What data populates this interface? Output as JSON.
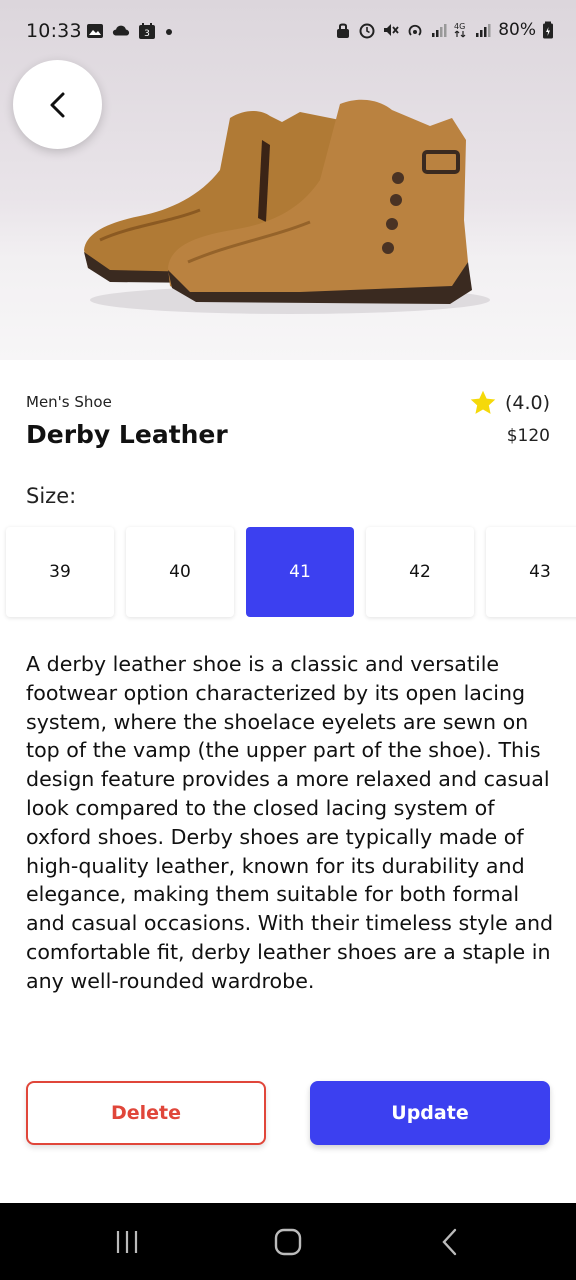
{
  "status_bar": {
    "time": "10:33",
    "battery": "80%",
    "network": "4G"
  },
  "product": {
    "category": "Men's Shoe",
    "name": "Derby Leather",
    "rating": "(4.0)",
    "price": "$120",
    "size_label": "Size:",
    "sizes": [
      {
        "label": "39",
        "selected": false
      },
      {
        "label": "40",
        "selected": false
      },
      {
        "label": "41",
        "selected": true
      },
      {
        "label": "42",
        "selected": false
      },
      {
        "label": "43",
        "selected": false
      }
    ],
    "description": "A derby leather shoe is a classic and versatile footwear option characterized by its open lacing system, where the shoelace eyelets are sewn on top of the vamp (the upper part of the shoe). This design feature provides a more relaxed and casual look compared to the closed lacing system of oxford shoes. Derby shoes are typically made of high-quality leather, known for its durability and elegance, making them suitable for both formal and casual occasions. With their timeless style and comfortable fit, derby leather shoes are a staple in any well-rounded wardrobe."
  },
  "actions": {
    "delete_label": "Delete",
    "update_label": "Update"
  },
  "colors": {
    "accent": "#3c40f0",
    "danger": "#e0463a",
    "star": "#f5d90a"
  },
  "icons": {
    "back": "chevron-left-icon",
    "rating": "star-icon",
    "nav": [
      "recent-apps-icon",
      "home-icon",
      "back-icon"
    ]
  }
}
